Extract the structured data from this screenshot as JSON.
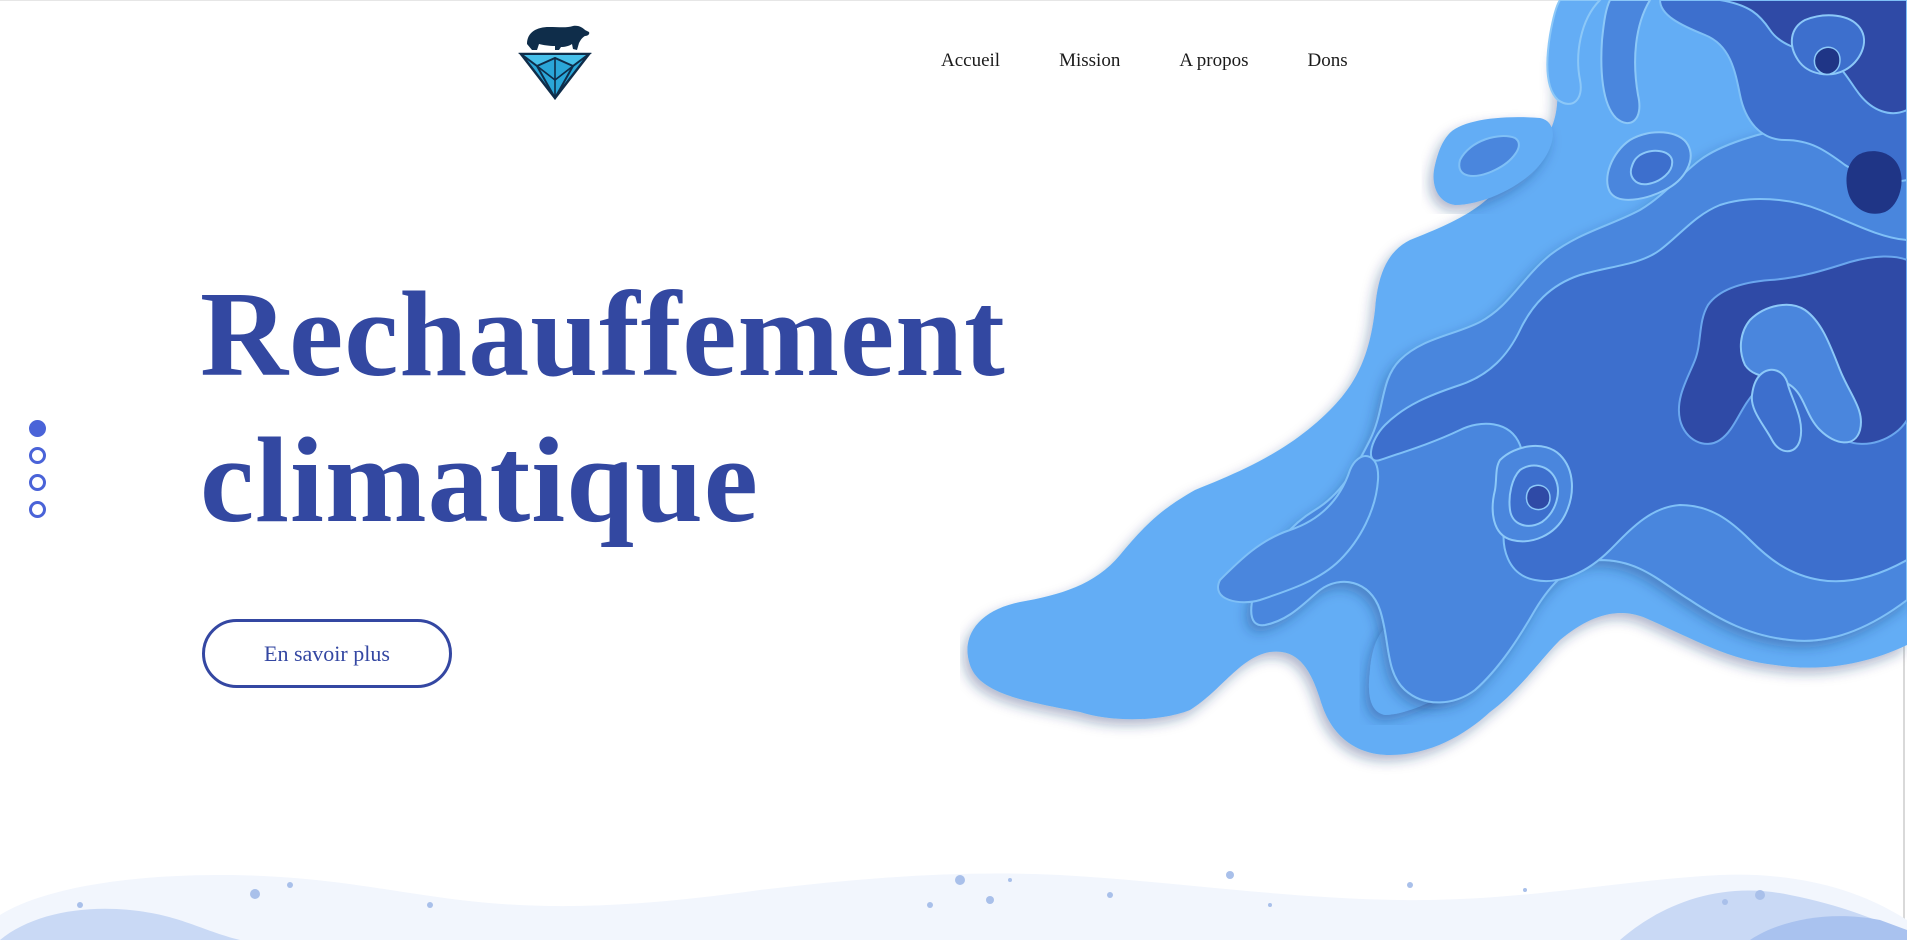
{
  "header": {
    "logo_icon": "polar-bear-on-diamond-icon",
    "nav": [
      {
        "label": "Accueil"
      },
      {
        "label": "Mission"
      },
      {
        "label": "A propos"
      },
      {
        "label": "Dons"
      }
    ]
  },
  "hero": {
    "title_line1": "Rechauffement",
    "title_line2": "climatique",
    "cta_label": "En savoir plus"
  },
  "pager": {
    "count": 4,
    "active_index": 0
  },
  "colors": {
    "primary": "#3348a1",
    "dot": "#4a63d8",
    "water_light": "#64adf5",
    "water_mid": "#4a82dc",
    "water_dark": "#2f4aa6"
  }
}
